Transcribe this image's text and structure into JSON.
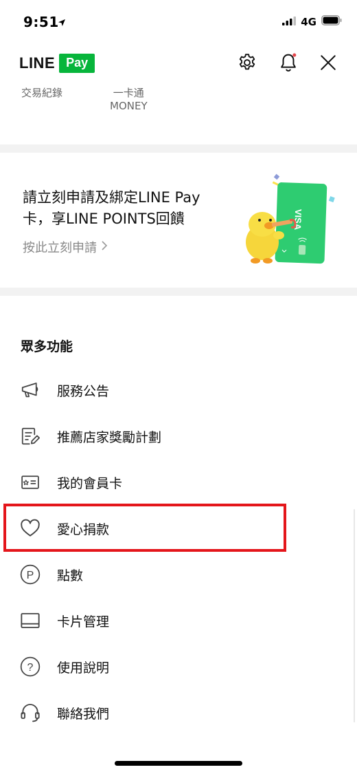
{
  "status_bar": {
    "time": "9:51",
    "network": "4G"
  },
  "header": {
    "logo_line": "LINE",
    "logo_pay": "Pay",
    "settings_icon": "gear-icon",
    "bell_icon": "bell-icon",
    "close_icon": "close-icon"
  },
  "subnav": {
    "items": [
      {
        "label": "交易紀錄"
      },
      {
        "label": "一卡通\nMONEY"
      }
    ]
  },
  "promo": {
    "title": "請立刻申請及綁定LINE Pay卡，享LINE POINTS回饋",
    "link": "按此立刻申請",
    "card_brand": "VISA"
  },
  "features": {
    "title": "眾多功能",
    "items": [
      {
        "label": "服務公告",
        "icon": "megaphone-icon"
      },
      {
        "label": "推薦店家獎勵計劃",
        "icon": "note-pen-icon"
      },
      {
        "label": "我的會員卡",
        "icon": "member-card-icon"
      },
      {
        "label": "愛心捐款",
        "icon": "heart-icon"
      },
      {
        "label": "點數",
        "icon": "points-icon"
      },
      {
        "label": "卡片管理",
        "icon": "card-icon"
      },
      {
        "label": "使用說明",
        "icon": "help-icon"
      },
      {
        "label": "聯絡我們",
        "icon": "headset-icon"
      }
    ]
  },
  "colors": {
    "brand_green": "#07b53b",
    "highlight": "#e4161b",
    "notification_dot": "#e4464b"
  }
}
